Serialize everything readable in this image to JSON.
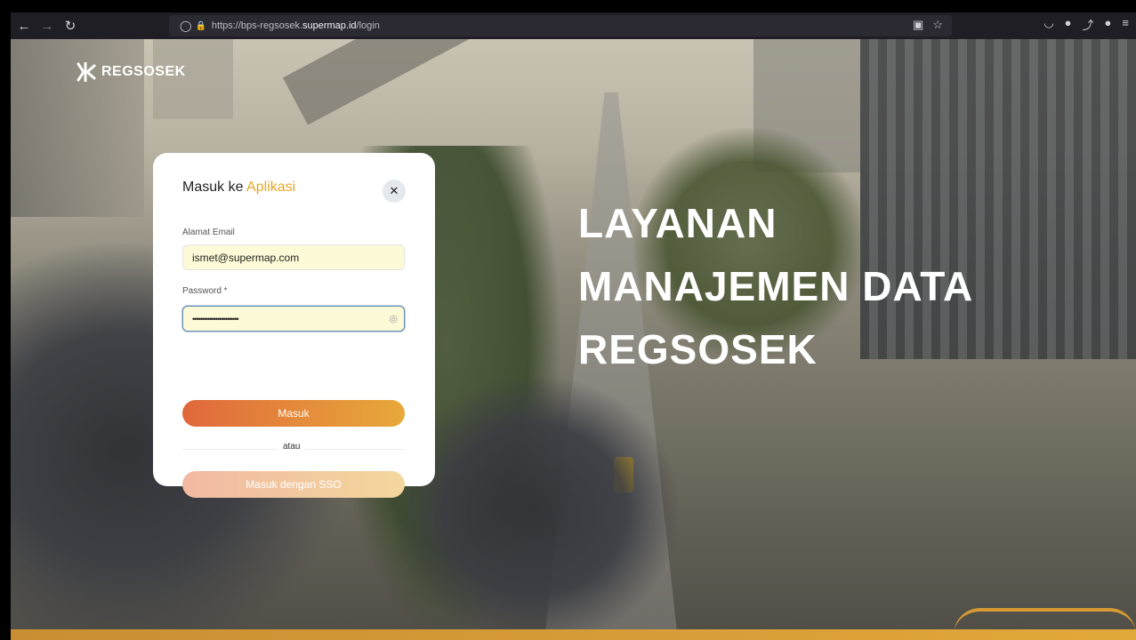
{
  "browser": {
    "url_prefix": "https://bps-regsosek.",
    "url_domain": "supermap.id",
    "url_path": "/login",
    "icons": {
      "back": "←",
      "forward": "→",
      "reload": "↻",
      "shield": "◯",
      "lock": "🔒",
      "reader": "▣",
      "bookmark": "☆",
      "pocket": "◡",
      "account": "●",
      "extensions": "⤴",
      "profile": "●",
      "menu": "≡"
    }
  },
  "logo": {
    "text": "REGSOSEK"
  },
  "hero": {
    "line1": "LAYANAN",
    "line2": "MANAJEMEN DATA",
    "line3": "REGSOSEK"
  },
  "login": {
    "title_prefix": "Masuk ke ",
    "title_accent": "Aplikasi",
    "close_icon": "✕",
    "email_label": "Alamat Email",
    "email_value": "ismet@supermap.com",
    "password_label": "Password *",
    "password_value": "••••••••••••••••••••••••",
    "eye_icon": "◎",
    "submit_label": "Masuk",
    "or_label": "atau",
    "sso_label": "Masuk dengan SSO"
  },
  "colors": {
    "accent": "#e6a628",
    "button_start": "#e0683c",
    "button_end": "#e8a93a"
  }
}
